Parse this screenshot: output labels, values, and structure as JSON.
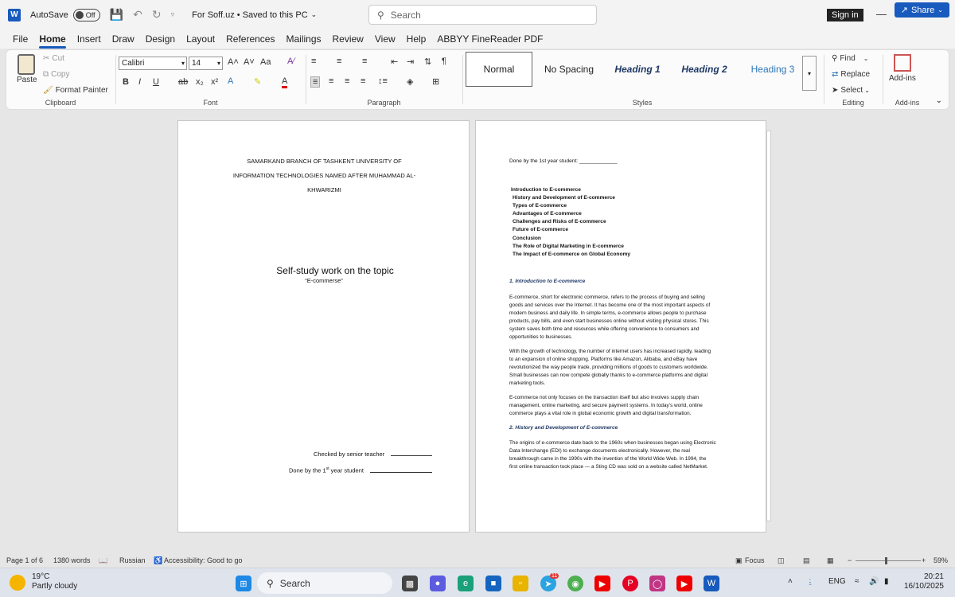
{
  "titlebar": {
    "app_logo": "W",
    "autosave_label": "AutoSave",
    "autosave_state": "Off",
    "doc_title": "For Soff.uz • Saved to this PC",
    "search_placeholder": "Search",
    "sign_in": "Sign in"
  },
  "menu": {
    "tabs": [
      "File",
      "Home",
      "Insert",
      "Draw",
      "Design",
      "Layout",
      "References",
      "Mailings",
      "Review",
      "View",
      "Help",
      "ABBYY FineReader PDF"
    ],
    "active_tab": "Home",
    "share": "Share"
  },
  "ribbon": {
    "clipboard": {
      "paste": "Paste",
      "cut": "Cut",
      "copy": "Copy",
      "format_painter": "Format Painter",
      "label": "Clipboard"
    },
    "font": {
      "family": "Calibri",
      "size": "14",
      "case": "Aa",
      "label": "Font"
    },
    "paragraph": {
      "label": "Paragraph"
    },
    "styles": {
      "items": [
        "Normal",
        "No Spacing",
        "Heading 1",
        "Heading 2",
        "Heading 3"
      ],
      "label": "Styles"
    },
    "editing": {
      "find": "Find",
      "replace": "Replace",
      "select": "Select",
      "label": "Editing"
    },
    "addins": {
      "button": "Add-ins",
      "label": "Add-ins"
    }
  },
  "page1": {
    "header_lines": [
      "SAMARKAND BRANCH OF TASHKENT UNIVERSITY OF",
      "INFORMATION TECHNOLOGIES NAMED AFTER MUHAMMAD AL-",
      "KHWARIZMI"
    ],
    "topic": "Self-study work on the topic",
    "subtitle": "“E-commerse”",
    "checked_by": "Checked by senior teacher",
    "done_by_prefix": "Done by the 1",
    "done_by_sup": "st",
    "done_by_suffix": " year student"
  },
  "page2": {
    "done_by": "Done by the 1st year student: _____________",
    "toc": [
      "Introduction to E-commerce",
      "History and Development of E-commerce",
      "Types of E-commerce",
      "Advantages of E-commerce",
      "Challenges and Risks of E-commerce",
      "Future of E-commerce",
      "Conclusion",
      "The Role of Digital Marketing in E-commerce",
      "The Impact of E-commerce on Global Economy"
    ],
    "section1_title": "1. Introduction to E-commerce",
    "para1": [
      "E-commerce, short for electronic commerce, refers to the process of buying and selling",
      "goods and services over the Internet. It has become one of the most important aspects of",
      "modern business and daily life. In simple terms, e-commerce allows people to purchase",
      "products, pay bills, and even start businesses online without visiting physical stores. This",
      "system saves both time and resources while offering convenience to consumers and",
      "opportunities to businesses."
    ],
    "para2": [
      "With the growth of technology, the number of internet users has increased rapidly, leading",
      "to an expansion of online shopping. Platforms like Amazon, Alibaba, and eBay have",
      "revolutionized the way people trade, providing millions of goods to customers worldwide.",
      "Small businesses can now compete globally thanks to e-commerce platforms and digital",
      "marketing tools."
    ],
    "para3": [
      "E-commerce not only focuses on the transaction itself but also involves supply chain",
      "management, online marketing, and secure payment systems. In today’s world, online",
      "commerce plays a vital role in global economic growth and digital transformation."
    ],
    "section2_title": "2. History and Development of E-commerce",
    "para4": [
      "The origins of e-commerce date back to the 1960s when businesses began using Electronic",
      "Data Interchange (EDI) to exchange documents electronically. However, the real",
      "breakthrough came in the 1990s with the invention of the World Wide Web. In 1994, the",
      "first online transaction took place — a Sting CD was sold on a website called NetMarket."
    ]
  },
  "statusbar": {
    "page": "Page 1 of 6",
    "words": "1380 words",
    "language": "Russian",
    "accessibility": "Accessibility: Good to go",
    "focus": "Focus",
    "zoom": "59%"
  },
  "taskbar": {
    "temp": "19°C",
    "weather": "Partly cloudy",
    "search": "Search",
    "badge": "11",
    "lang": "ENG",
    "time": "20:21",
    "date": "16/10/2025"
  },
  "colors": {
    "accent": "#185abd",
    "heading": "#1f3864"
  }
}
